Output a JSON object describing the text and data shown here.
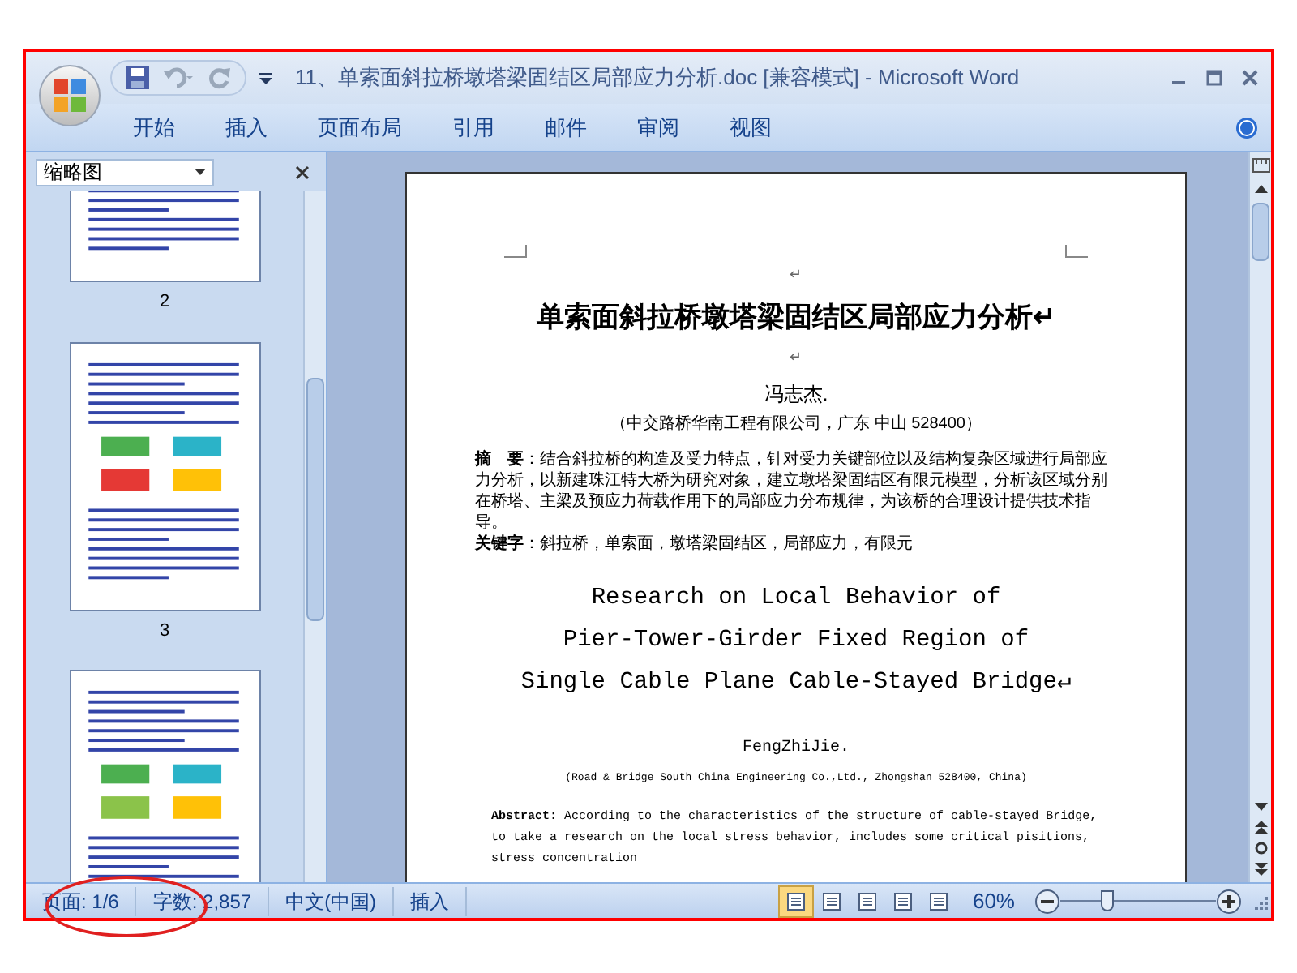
{
  "window": {
    "title": "11、单索面斜拉桥墩塔梁固结区局部应力分析.doc [兼容模式] - Microsoft Word"
  },
  "ribbon_tabs": [
    "开始",
    "插入",
    "页面布局",
    "引用",
    "邮件",
    "审阅",
    "视图"
  ],
  "thumbnail_pane": {
    "title": "缩略图",
    "page_labels": [
      "2",
      "3"
    ]
  },
  "document": {
    "top_mark": "↵",
    "title": "单索面斜拉桥墩塔梁固结区局部应力分析↵",
    "blank_mark": "↵",
    "author": "冯志杰.",
    "affiliation": "（中交路桥华南工程有限公司，广东 中山 528400）",
    "abstract": "**摘　要**：结合斜拉桥的构造及受力特点，针对受力关键部位以及结构复杂区域进行局部应力分析，以新建珠江特大桥为研究对象，建立墩塔梁固结区有限元模型，分析该区域分别在桥塔、主梁及预应力荷载作用下的局部应力分布规律，为该桥的合理设计提供技术指导。",
    "keywords": "**关键字**：斜拉桥，单索面，墩塔梁固结区，局部应力，有限元",
    "title_en": [
      "Research on Local Behavior of",
      "Pier-Tower-Girder Fixed Region of",
      "Single Cable Plane Cable-Stayed Bridge↵"
    ],
    "author_en": "FengZhiJie.",
    "affiliation_en": "(Road & Bridge South China Engineering Co.,Ltd., Zhongshan 528400, China)",
    "abstract_en": "**Abstract**: According to the characteristics of the structure of cable-stayed Bridge, to take a research on the local stress behavior, includes some critical pisitions, stress concentration"
  },
  "status_bar": {
    "page": "页面: 1/6",
    "words": "字数: 2,857",
    "language": "中文(中国)",
    "mode": "插入",
    "views": [
      {
        "selected": true
      },
      {
        "selected": false
      },
      {
        "selected": false
      },
      {
        "selected": false
      },
      {
        "selected": false
      }
    ],
    "zoom": "60%",
    "zoom_slider": {
      "level": 0.3
    }
  }
}
